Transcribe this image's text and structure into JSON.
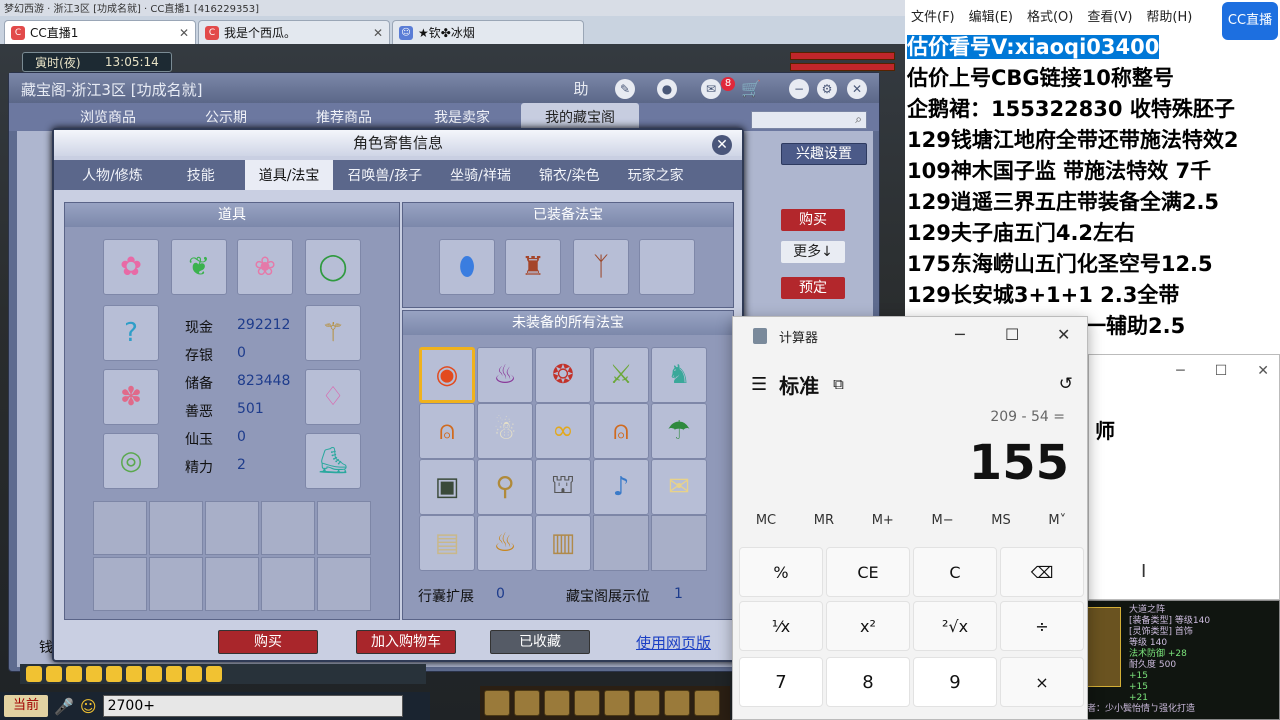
{
  "browser": {
    "top_text": "梦幻西游 · 浙江3区 [功成名就]  ·  CC直播1 [416229353]",
    "tabs": [
      {
        "label": "CC直播1",
        "icon": "cc-icon"
      },
      {
        "label": "我是个西瓜。",
        "icon": "cc-icon"
      },
      {
        "label": "★钦✤冰烟",
        "icon": "avatar-icon"
      }
    ]
  },
  "game": {
    "time_badge": {
      "period": "寅时(夜)",
      "clock": "13:05:14"
    },
    "chat": {
      "mode": "当前",
      "input": "2700+"
    }
  },
  "cbg": {
    "title": "藏宝阁-浙江3区 [功成名就]",
    "help": "助",
    "cart_count": "8",
    "nav": [
      "浏览商品",
      "公示期",
      "推荐商品",
      "我是卖家",
      "我的藏宝阁"
    ],
    "interest_btn": "兴趣设置",
    "side_buttons": {
      "buy": "购买",
      "more": "更多↓",
      "reserve": "预定"
    },
    "bottom_label": "钱"
  },
  "dialog": {
    "title": "角色寄售信息",
    "tabs": [
      "人物/修炼",
      "技能",
      "道具/法宝",
      "召唤兽/孩子",
      "坐骑/祥瑞",
      "锦衣/染色",
      "玩家之家"
    ],
    "items_header": "道具",
    "equipped_header": "已装备法宝",
    "unequipped_header": "未装备的所有法宝",
    "stats": [
      {
        "k": "现金",
        "v": "292212"
      },
      {
        "k": "存银",
        "v": "0"
      },
      {
        "k": "储备",
        "v": "823448"
      },
      {
        "k": "善恶",
        "v": "501"
      },
      {
        "k": "仙玉",
        "v": "0"
      },
      {
        "k": "精力",
        "v": "2"
      }
    ],
    "footer": {
      "bag_label": "行囊扩展",
      "bag_value": "0",
      "show_label": "藏宝阁展示位",
      "show_value": "1"
    },
    "buttons": {
      "buy": "购买",
      "add_cart": "加入购物车",
      "collected": "已收藏",
      "web": "使用网页版"
    }
  },
  "notepad": {
    "menu": [
      "文件(F)",
      "编辑(E)",
      "格式(O)",
      "查看(V)",
      "帮助(H)"
    ],
    "lines": [
      "估价看号V:xiaoqi03400",
      "估价上号CBG链接10称整号",
      "企鹅裙：155322830 收特殊胚子",
      "129钱塘江地府全带还带施法特效2",
      "109神木国子监 带施法特效 7千",
      "129逍遥三界五庄带装备全满2.5",
      "129夫子庙五门4.2左右",
      "175东海崂山五门化圣空号12.5",
      "129长安城3+1+1 2.3全带",
      "一辅助2.5"
    ],
    "logo": "CC直播"
  },
  "window2": {
    "text": "师"
  },
  "tooltip": {
    "title": "大道之阵",
    "lines": [
      "[装备类型] 等级140",
      "[灵饰类型] 首饰",
      "等级 140",
      "法术防御 +28",
      "耐久度 500",
      "+15",
      "+15",
      "+21",
      "制造者：少小鬓怡情ㄅ强化打造"
    ]
  },
  "calculator": {
    "title": "计算器",
    "mode": "标准",
    "expression": "209 - 54 =",
    "display": "155",
    "memory": [
      "MC",
      "MR",
      "M+",
      "M−",
      "MS",
      "M˅"
    ],
    "keys_row1": [
      "%",
      "CE",
      "C",
      "⌫"
    ],
    "keys_row2": [
      "¹⁄x",
      "x²",
      "²√x",
      "÷"
    ],
    "keys_row3": [
      "7",
      "8",
      "9",
      "×"
    ]
  }
}
